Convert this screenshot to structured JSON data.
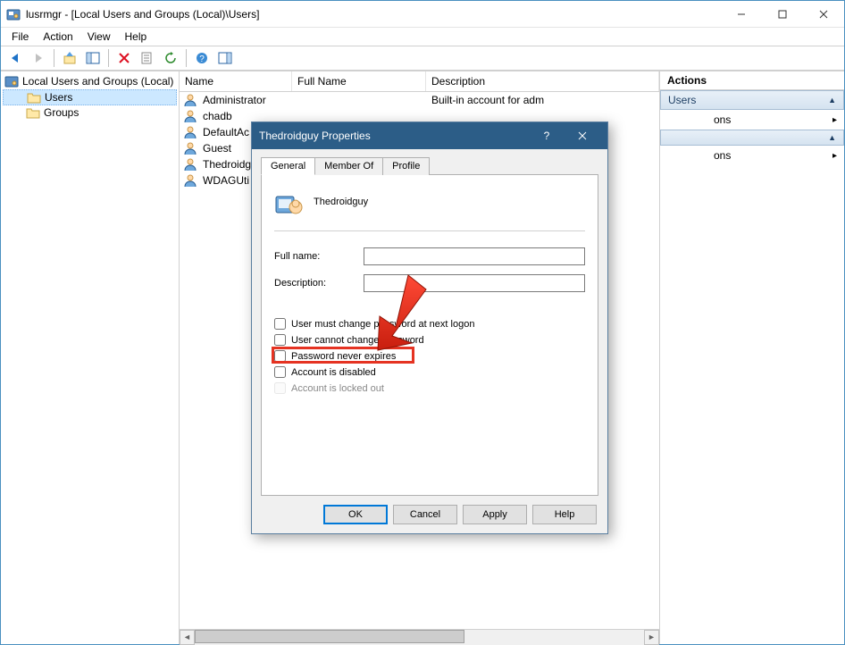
{
  "window": {
    "title": "lusrmgr - [Local Users and Groups (Local)\\Users]"
  },
  "menubar": {
    "items": [
      "File",
      "Action",
      "View",
      "Help"
    ]
  },
  "tree": {
    "root": "Local Users and Groups (Local)",
    "children": [
      {
        "label": "Users",
        "selected": true
      },
      {
        "label": "Groups",
        "selected": false
      }
    ]
  },
  "list": {
    "columns": {
      "name": "Name",
      "full": "Full Name",
      "desc": "Description"
    },
    "rows": [
      {
        "name": "Administrator",
        "full": "",
        "desc": "Built-in account for adm"
      },
      {
        "name": "chadb",
        "full": "",
        "desc": ""
      },
      {
        "name": "DefaultAc",
        "full": "",
        "desc": ""
      },
      {
        "name": "Guest",
        "full": "",
        "desc": ""
      },
      {
        "name": "Thedroidg",
        "full": "",
        "desc": ""
      },
      {
        "name": "WDAGUti",
        "full": "",
        "desc": ""
      }
    ]
  },
  "actions": {
    "title": "Actions",
    "groups": [
      {
        "header": "Users",
        "items": [
          {
            "label": "ons",
            "hasSub": true
          }
        ]
      },
      {
        "header": "",
        "items": [
          {
            "label": "ons",
            "hasSub": true
          }
        ]
      }
    ]
  },
  "dialog": {
    "title": "Thedroidguy Properties",
    "tabs": [
      "General",
      "Member Of",
      "Profile"
    ],
    "activeTab": 0,
    "userDisplay": "Thedroidguy",
    "fields": {
      "fullname_label": "Full name:",
      "fullname_value": "",
      "description_label": "Description:",
      "description_value": ""
    },
    "checkboxes": {
      "mustChange": {
        "label": "User must change password at next logon",
        "checked": false,
        "disabled": false
      },
      "cannotChange": {
        "label": "User cannot change password",
        "checked": false,
        "disabled": false
      },
      "neverExpire": {
        "label": "Password never expires",
        "checked": false,
        "disabled": false
      },
      "disabled": {
        "label": "Account is disabled",
        "checked": false,
        "disabled": false
      },
      "locked": {
        "label": "Account is locked out",
        "checked": false,
        "disabled": true
      }
    },
    "buttons": {
      "ok": "OK",
      "cancel": "Cancel",
      "apply": "Apply",
      "help": "Help"
    }
  },
  "annotation": {
    "highlight_target": "password-never-expires-checkbox"
  }
}
